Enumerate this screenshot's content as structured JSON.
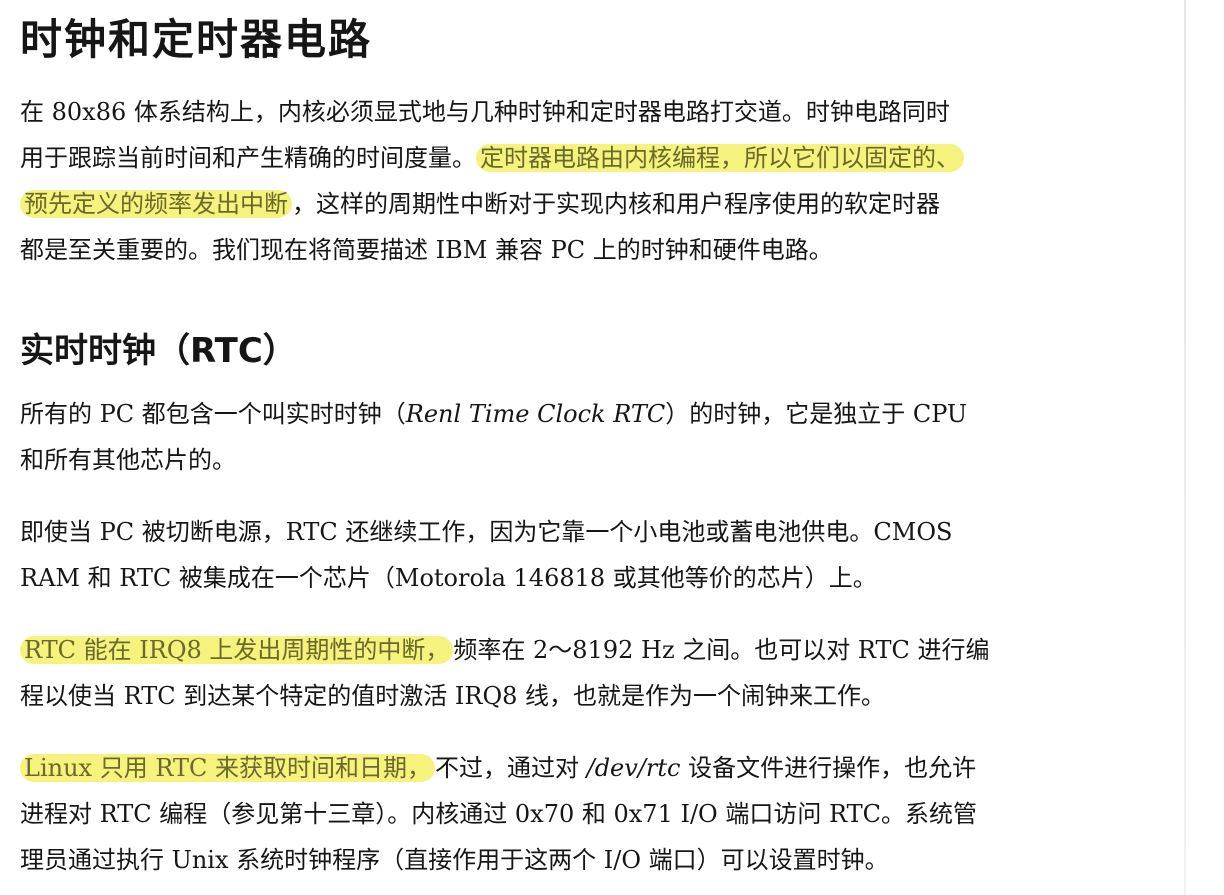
{
  "title": "时钟和定时器电路",
  "intro": {
    "l1": "在 80x86 体系结构上，内核必须显式地与几种时钟和定时器电路打交道。时钟电路同时",
    "l2_a": "用于跟踪当前时间和产生精确的时间度量。",
    "l2_hl": "定时器电路由内核编程，所以它们以固定的、",
    "l3_hl": "预先定义的频率发出中断",
    "l3_b": "，这样的周期性中断对于实现内核和用户程序使用的软定时器",
    "l4": "都是至关重要的。我们现在将简要描述 IBM 兼容 PC 上的时钟和硬件电路。"
  },
  "section_heading": "实时时钟（RTC）",
  "p1": {
    "l1_a": "所有的 PC 都包含一个叫实时时钟（",
    "l1_em": "Renl Time Clock RTC",
    "l1_b": "）的时钟，它是独立于 CPU",
    "l2": "和所有其他芯片的。"
  },
  "p2": {
    "l1": "即使当 PC 被切断电源，RTC 还继续工作，因为它靠一个小电池或蓄电池供电。CMOS",
    "l2": "RAM 和 RTC 被集成在一个芯片（Motorola 146818 或其他等价的芯片）上。"
  },
  "p3": {
    "l1_hl": "RTC 能在 IRQ8 上发出周期性的中断，",
    "l1_b": "频率在 2～8192 Hz 之间。也可以对 RTC 进行编",
    "l2": "程以使当 RTC 到达某个特定的值时激活 IRQ8 线，也就是作为一个闹钟来工作。"
  },
  "p4": {
    "l1_hl": "Linux 只用 RTC 来获取时间和日期，",
    "l1_b": "不过，通过对 ",
    "l1_em": "/dev/rtc",
    "l1_c": " 设备文件进行操作，也允许",
    "l2": "进程对 RTC 编程（参见第十三章）。内核通过 0x70 和 0x71 I/O 端口访问 RTC。系统管",
    "l3": "理员通过执行 Unix 系统时钟程序（直接作用于这两个 I/O 端口）可以设置时钟。"
  },
  "colors": {
    "highlight": "#f5f27e",
    "text": "#161616"
  }
}
